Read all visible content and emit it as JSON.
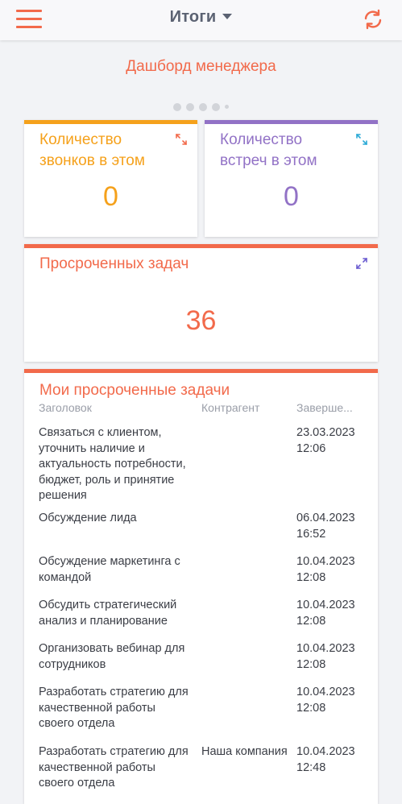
{
  "header": {
    "title": "Итоги",
    "menu_icon": "hamburger-icon",
    "refresh_icon": "refresh-icon",
    "accent": "#f26a4b"
  },
  "dashboard_title": "Дашборд менеджера",
  "pager": {
    "pages": 5,
    "active": 0
  },
  "cards": {
    "calls": {
      "title_line1": "Количество",
      "title_line2": "звонков в этом",
      "value": "0",
      "color": "#f5a11b"
    },
    "meetings": {
      "title_line1": "Количество",
      "title_line2": "встреч в этом",
      "value": "0",
      "color": "#9272c6"
    },
    "overdue": {
      "title": "Просроченных задач",
      "value": "36",
      "color": "#f26a4b"
    }
  },
  "tasks": {
    "title": "Мои просроченные задачи",
    "columns": {
      "title": "Заголовок",
      "contractor": "Контрагент",
      "completion": "Заверше..."
    },
    "rows": [
      {
        "title": "Связаться с клиентом, уточнить наличие и актуальность потребности, бюджет, роль и принятие решения",
        "contractor": "",
        "date": "23.03.2023",
        "time": "12:06"
      },
      {
        "title": "Обсуждение лида",
        "contractor": "",
        "date": "06.04.2023",
        "time": "16:52"
      },
      {
        "title": "Обсуждение маркетинга с командой",
        "contractor": "",
        "date": "10.04.2023",
        "time": "12:08"
      },
      {
        "title": "Обсудить стратегический анализ и планирование",
        "contractor": "",
        "date": "10.04.2023",
        "time": "12:08"
      },
      {
        "title": "Организовать вебинар для сотрудников",
        "contractor": "",
        "date": "10.04.2023",
        "time": "12:08"
      },
      {
        "title": "Разработать стратегию для качественной работы своего отдела",
        "contractor": "",
        "date": "10.04.2023",
        "time": "12:08"
      },
      {
        "title": "Разработать стратегию для качественной работы своего отдела",
        "contractor": "Наша компания",
        "date": "10.04.2023",
        "time": "12:48"
      }
    ]
  }
}
